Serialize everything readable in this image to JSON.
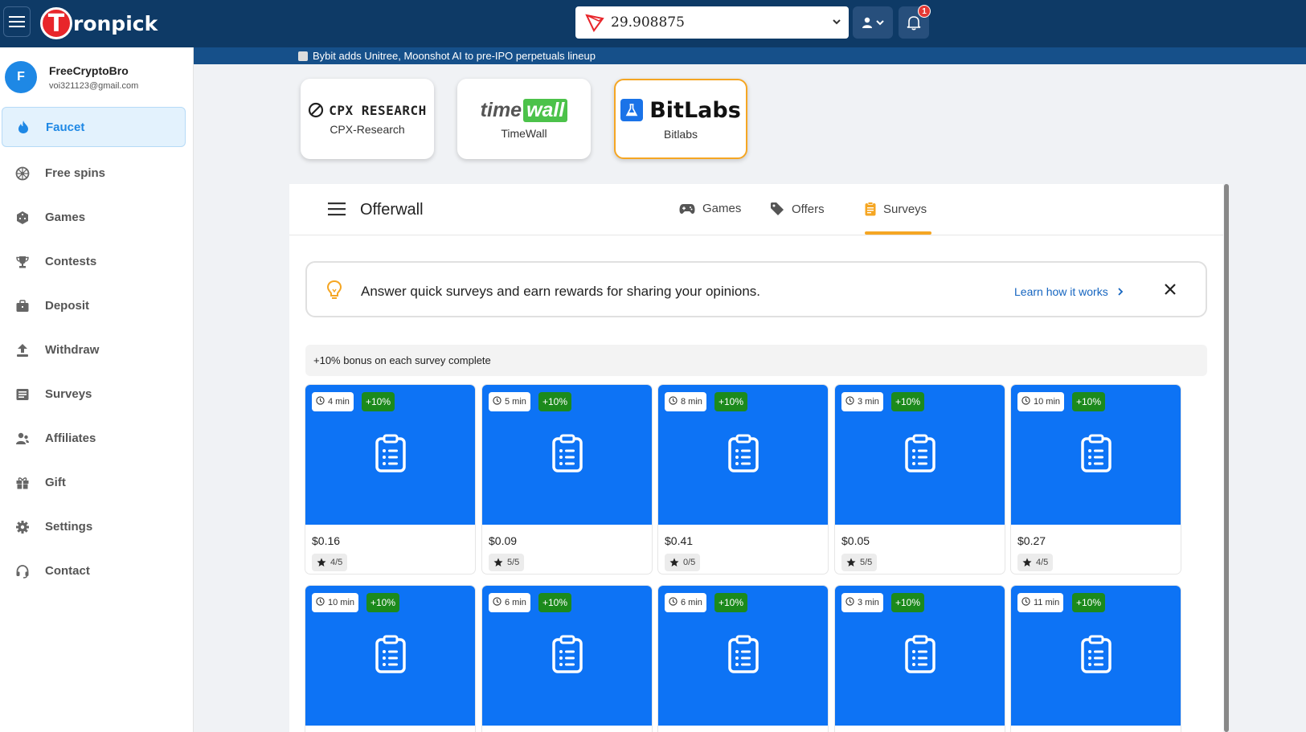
{
  "app": {
    "brand_letter": "T",
    "brand_text": "ronpick",
    "balance": "29.908875",
    "notification_count": "1"
  },
  "ticker": {
    "text": "Bybit adds Unitree, Moonshot AI to pre-IPO perpetuals lineup"
  },
  "user": {
    "initial": "F",
    "name": "FreeCryptoBro",
    "email": "voi321123@gmail.com"
  },
  "nav": [
    {
      "label": "Faucet",
      "icon": "fire-icon",
      "active": true
    },
    {
      "label": "Free spins",
      "icon": "wheel-icon"
    },
    {
      "label": "Games",
      "icon": "dice-icon"
    },
    {
      "label": "Contests",
      "icon": "trophy-icon"
    },
    {
      "label": "Deposit",
      "icon": "briefcase-icon"
    },
    {
      "label": "Withdraw",
      "icon": "upload-icon"
    },
    {
      "label": "Surveys",
      "icon": "list-icon"
    },
    {
      "label": "Affiliates",
      "icon": "users-icon"
    },
    {
      "label": "Gift",
      "icon": "gift-icon"
    },
    {
      "label": "Settings",
      "icon": "gear-icon"
    },
    {
      "label": "Contact",
      "icon": "headset-icon"
    }
  ],
  "providers": [
    {
      "logo_text": "CPX RESEARCH",
      "label": "CPX-Research"
    },
    {
      "logo_time": "time",
      "logo_wall": "wall",
      "label": "TimeWall"
    },
    {
      "logo_text": "BitLabs",
      "label": "Bitlabs",
      "active": true
    }
  ],
  "offerwall": {
    "title": "Offerwall",
    "tabs": [
      {
        "label": "Games",
        "icon": "gamepad-icon"
      },
      {
        "label": "Offers",
        "icon": "tag-icon"
      },
      {
        "label": "Surveys",
        "icon": "clipboard-icon",
        "active": true
      }
    ],
    "info_text": "Answer quick surveys and earn rewards for sharing your opinions.",
    "info_link": "Learn how it works",
    "bonus_text": "+10% bonus on each survey complete"
  },
  "surveys": [
    {
      "time": "4 min",
      "bonus": "+10%",
      "price": "$0.16",
      "rating": "4/5"
    },
    {
      "time": "5 min",
      "bonus": "+10%",
      "price": "$0.09",
      "rating": "5/5"
    },
    {
      "time": "8 min",
      "bonus": "+10%",
      "price": "$0.41",
      "rating": "0/5"
    },
    {
      "time": "3 min",
      "bonus": "+10%",
      "price": "$0.05",
      "rating": "5/5"
    },
    {
      "time": "10 min",
      "bonus": "+10%",
      "price": "$0.27",
      "rating": "4/5"
    },
    {
      "time": "10 min",
      "bonus": "+10%",
      "price": "",
      "rating": ""
    },
    {
      "time": "6 min",
      "bonus": "+10%",
      "price": "",
      "rating": ""
    },
    {
      "time": "6 min",
      "bonus": "+10%",
      "price": "",
      "rating": ""
    },
    {
      "time": "3 min",
      "bonus": "+10%",
      "price": "",
      "rating": ""
    },
    {
      "time": "11 min",
      "bonus": "+10%",
      "price": "",
      "rating": ""
    }
  ],
  "colors": {
    "topbar": "#0e3a66",
    "accent": "#1e88e5",
    "card_blue": "#0d73f5",
    "bonus_green": "#1c8a1c",
    "tab_active": "#f5a623"
  }
}
